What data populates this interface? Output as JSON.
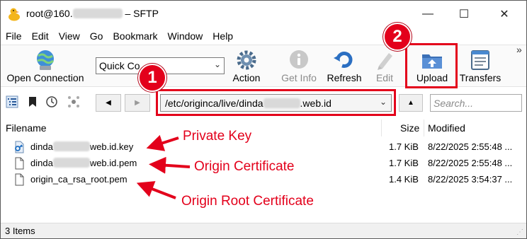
{
  "window": {
    "title_prefix": "root@160.",
    "title_suffix": "– SFTP",
    "controls": {
      "minimize": "—",
      "maximize": "☐",
      "close": "✕"
    }
  },
  "menu": [
    "File",
    "Edit",
    "View",
    "Go",
    "Bookmark",
    "Window",
    "Help"
  ],
  "toolbar": {
    "open_connection": "Open Connection",
    "quick_connect": "Quick Co",
    "action": "Action",
    "get_info": "Get Info",
    "refresh": "Refresh",
    "edit": "Edit",
    "upload": "Upload",
    "transfers": "Transfers",
    "more": "»"
  },
  "pathbar": {
    "path_prefix": "/etc/originca/live/dinda",
    "path_suffix": ".web.id",
    "search_placeholder": "Search..."
  },
  "columns": {
    "filename": "Filename",
    "size": "Size",
    "modified": "Modified"
  },
  "files": [
    {
      "name_prefix": "dinda",
      "name_suffix": "web.id.key",
      "name": "",
      "size": "1.7 KiB",
      "modified": "8/22/2025 2:55:48 ...",
      "icon": "key-file-icon"
    },
    {
      "name_prefix": "dinda",
      "name_suffix": "web.id.pem",
      "name": "",
      "size": "1.7 KiB",
      "modified": "8/22/2025 2:55:48 ...",
      "icon": "document-icon"
    },
    {
      "name_prefix": "",
      "name_suffix": "",
      "name": "origin_ca_rsa_root.pem",
      "size": "1.4 KiB",
      "modified": "8/22/2025 3:54:37 ...",
      "icon": "document-icon"
    }
  ],
  "status": {
    "items": "3 Items"
  },
  "annotations": {
    "badge_1": "1",
    "badge_2": "2",
    "private_key": "Private Key",
    "origin_certificate": "Origin Certificate",
    "origin_root_certificate": "Origin Root Certificate",
    "accent_color": "#e3001b"
  }
}
